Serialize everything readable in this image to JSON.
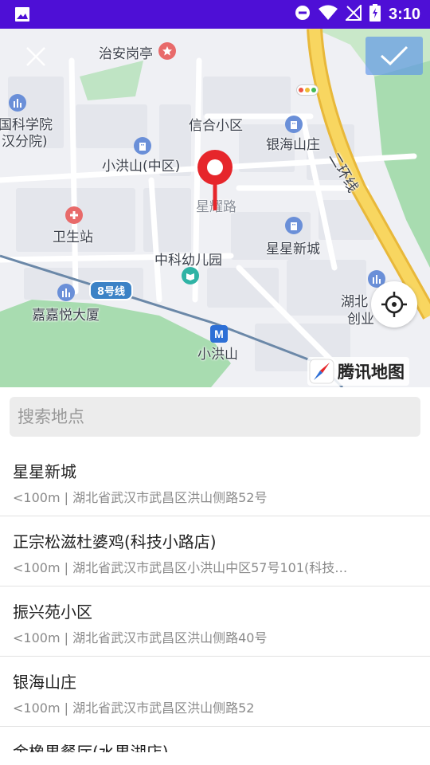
{
  "status_bar": {
    "time": "3:10",
    "icons": [
      "image-icon",
      "do-not-disturb-icon",
      "wifi-icon",
      "no-signal-icon",
      "battery-charging-icon"
    ]
  },
  "map": {
    "labels": {
      "zhian": "治安岗亭",
      "kexueyuan_1": "国科学院",
      "kexueyuan_2": "汉分院)",
      "xinhe": "信合小区",
      "yinhai": "银海山庄",
      "xiaohongshan": "小洪山(中区)",
      "xingyao": "星耀路",
      "weisheng": "卫生站",
      "xingxing": "星星新城",
      "youeryuan": "中科幼儿园",
      "line8": "8号线",
      "jiajia": "嘉嘉悦大厦",
      "xiaohongshan_station": "小洪山",
      "hubei_1": "湖北",
      "hubei_2": "创业",
      "ring": "二环线",
      "metro_mark": "M"
    },
    "logo_text": "腾讯地图",
    "colors": {
      "road_yellow": "#f5c94a",
      "park_green": "#a8dcb0",
      "pin_red": "#e6262b",
      "confirm_blue": "#5a94ea"
    }
  },
  "search": {
    "placeholder": "搜索地点",
    "value": ""
  },
  "results": [
    {
      "name": "星星新城",
      "address": "<100m | 湖北省武汉市武昌区洪山侧路52号"
    },
    {
      "name": "正宗松滋杜婆鸡(科技小路店)",
      "address": "<100m | 湖北省武汉市武昌区小洪山中区57号101(科技…"
    },
    {
      "name": "振兴苑小区",
      "address": "<100m | 湖北省武汉市武昌区洪山侧路40号"
    },
    {
      "name": "银海山庄",
      "address": "<100m | 湖北省武汉市武昌区洪山侧路52"
    },
    {
      "name": "金橡果餐厅(水果湖店)",
      "address": ""
    }
  ]
}
